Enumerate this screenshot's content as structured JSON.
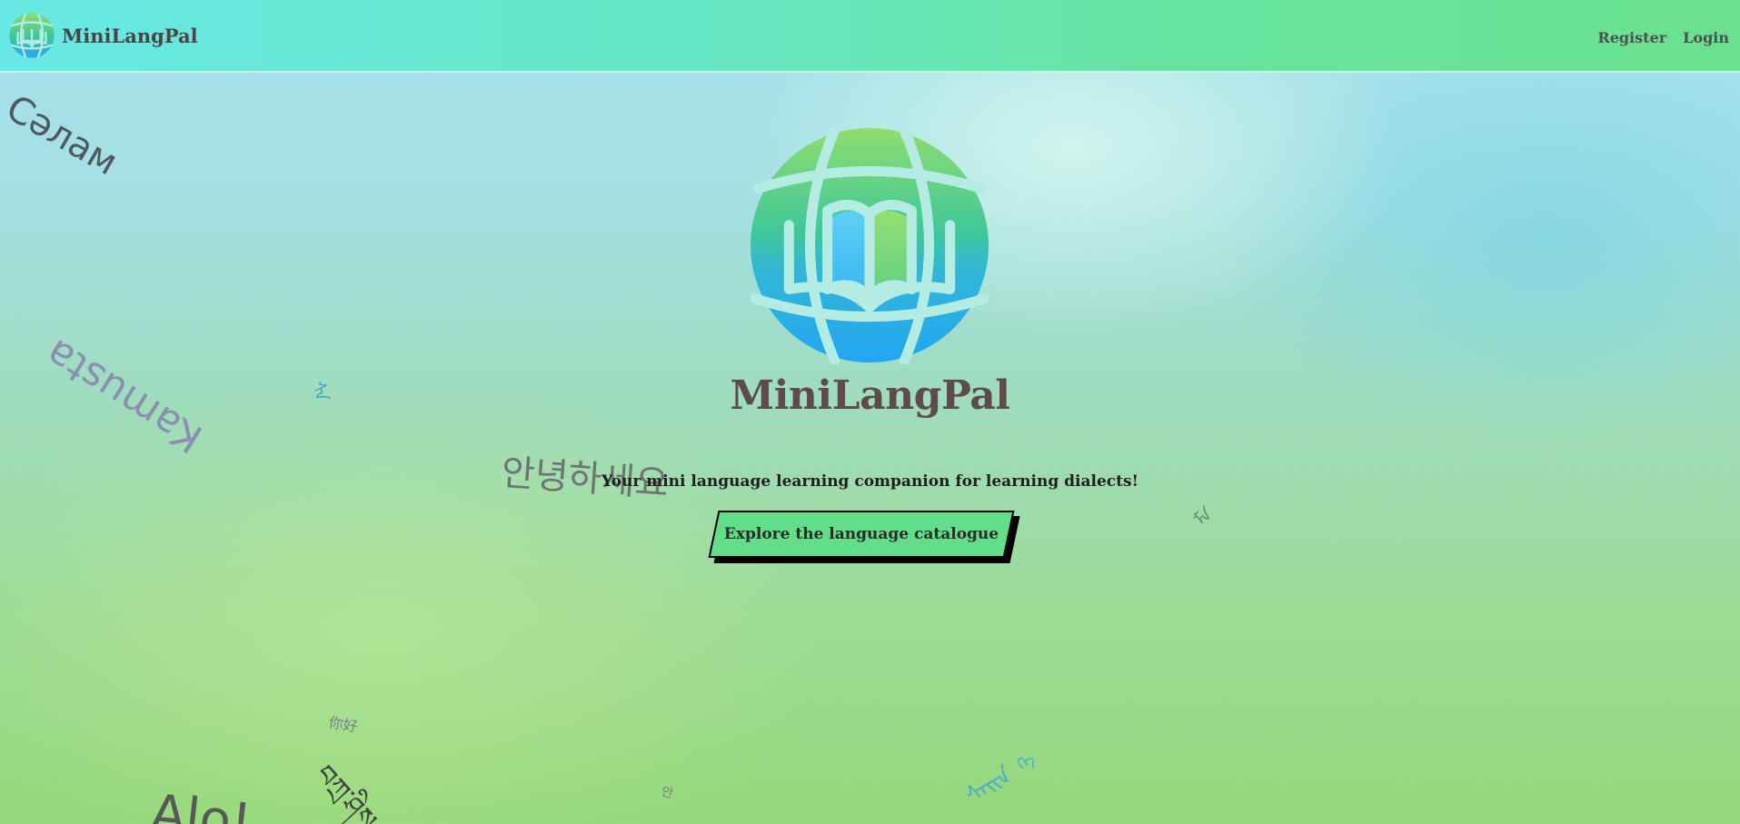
{
  "navbar": {
    "brand_name": "MiniLangPal",
    "links": [
      {
        "label": "Register"
      },
      {
        "label": "Login"
      }
    ]
  },
  "hero": {
    "title": "MiniLangPal",
    "tagline": "Your mini language learning companion for learning dialects!",
    "cta_label": "Explore the language catalogue"
  },
  "floating_words": {
    "salam": "Сәлам",
    "kamusta": "Kamusta",
    "annyeong": "안녕하세요",
    "alo": "Alo!",
    "tibetan": "བཀྲ་ཤིས",
    "small_1": "ᠰᠠ",
    "small_2": "ᠮᠡ",
    "small_3": "你好",
    "small_4": "ᠰᠠᠢᠨ",
    "small_5": "안",
    "small_6": "ᠬᠡ"
  },
  "colors": {
    "navbar": "#66e7c4",
    "cta": "#62dd8a",
    "title": "#5e4c4c"
  },
  "icons": {
    "brand_logo": "globe-book-icon",
    "hero_logo": "globe-book-icon"
  }
}
